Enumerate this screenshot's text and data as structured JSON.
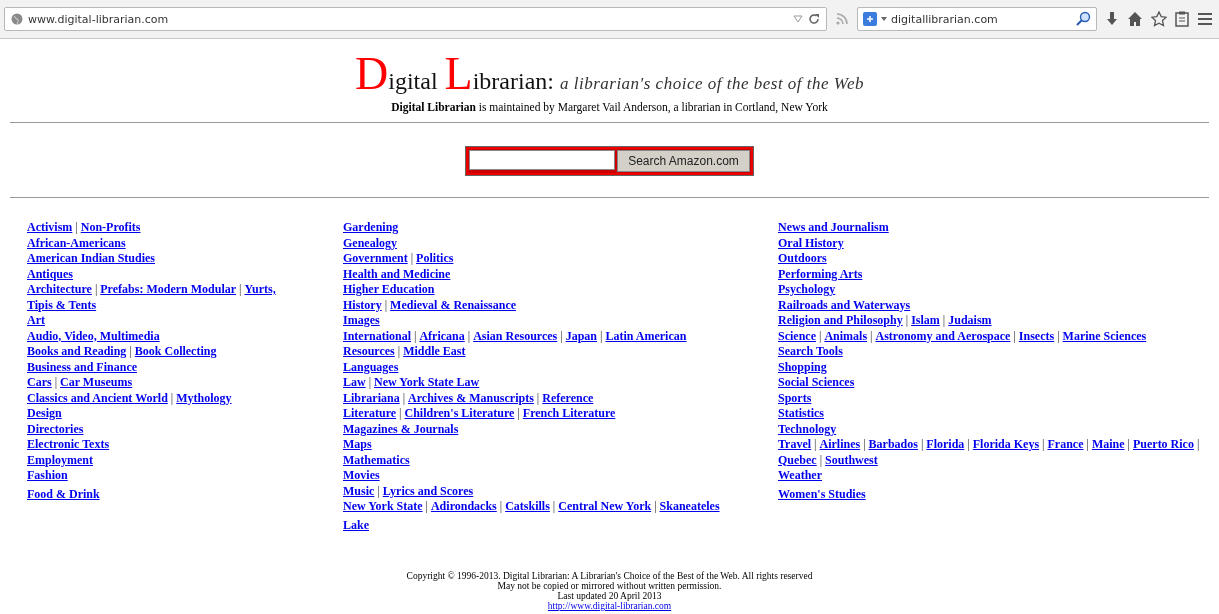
{
  "browser": {
    "url": "www.digital-librarian.com",
    "search_value": "digitallibrarian.com"
  },
  "header": {
    "logo": [
      {
        "initial": "D",
        "rest": "igital"
      },
      {
        "initial": "L",
        "rest": "ibrarian:"
      }
    ],
    "tagline": "a librarian's choice of the best of the Web",
    "byline": "**Digital Librarian** is maintained by Margaret Vail Anderson, a librarian in Cortland, New York"
  },
  "search": {
    "button": "Search Amazon.com"
  },
  "columns": [
    [
      [
        "Activism",
        "|",
        "Non-Profits"
      ],
      [
        "African-Americans"
      ],
      [
        "American Indian Studies"
      ],
      [
        "Antiques"
      ],
      [
        "Architecture",
        "|",
        "Prefabs: Modern Modular",
        "|",
        "Yurts,"
      ],
      [
        "Tipis & Tents"
      ],
      [
        "Art"
      ],
      [
        "Audio, Video, Multimedia"
      ],
      [
        "Books and Reading",
        "|",
        "Book Collecting"
      ],
      [
        "Business and Finance"
      ],
      [
        "Cars",
        "|",
        "Car Museums"
      ],
      [
        "Classics and Ancient World",
        "|",
        "Mythology"
      ],
      [
        "Design"
      ],
      [
        "Directories"
      ],
      [
        "Electronic Texts"
      ],
      [
        "Employment"
      ],
      [
        "Fashion"
      ],
      [
        "Food & Drink"
      ]
    ],
    [
      [
        "Gardening"
      ],
      [
        "Genealogy"
      ],
      [
        "Government",
        "|",
        "Politics"
      ],
      [
        "Health and Medicine"
      ],
      [
        "Higher Education"
      ],
      [
        "History",
        "|",
        "Medieval & Renaissance"
      ],
      [
        "Images"
      ],
      [
        "International",
        "|",
        "Africana",
        "|",
        "Asian Resources",
        "|",
        "Japan",
        "|",
        "Latin American"
      ],
      [
        "Resources",
        "|",
        "Middle East"
      ],
      [
        "Languages"
      ],
      [
        "Law",
        "|",
        "New York State Law"
      ],
      [
        "Librariana",
        "|",
        "Archives & Manuscripts",
        "|",
        "Reference"
      ],
      [
        "Literature",
        "|",
        "Children's Literature",
        "|",
        "French Literature"
      ],
      [
        "Magazines & Journals"
      ],
      [
        "Maps"
      ],
      [
        "Mathematics"
      ],
      [
        "Movies"
      ],
      [
        "Music",
        "|",
        "Lyrics and Scores"
      ],
      [
        "New York State",
        "|",
        "Adirondacks",
        "|",
        "Catskills",
        "|",
        "Central New York",
        "|",
        "Skaneateles"
      ],
      [
        "Lake"
      ]
    ],
    [
      [
        "News and Journalism"
      ],
      [
        "Oral History"
      ],
      [
        "Outdoors"
      ],
      [
        "Performing Arts"
      ],
      [
        "Psychology"
      ],
      [
        "Railroads and Waterways"
      ],
      [
        "Religion and Philosophy",
        "|",
        "Islam",
        "|",
        "Judaism"
      ],
      [
        "Science",
        "|",
        "Animals",
        "|",
        "Astronomy and Aerospace",
        "|",
        "Insects",
        "|",
        "Marine Sciences"
      ],
      [
        "Search Tools"
      ],
      [
        "Shopping"
      ],
      [
        "Social Sciences"
      ],
      [
        "Sports"
      ],
      [
        "Statistics"
      ],
      [
        "Technology"
      ],
      [
        "Travel",
        "|",
        "Airlines",
        "|",
        "Barbados",
        "|",
        "Florida",
        "|",
        "Florida Keys",
        "|",
        "France",
        "|",
        "Maine",
        "|",
        "Puerto Rico",
        "|"
      ],
      [
        "Quebec",
        "|",
        "Southwest"
      ],
      [
        "Weather"
      ],
      [
        "Women's Studies"
      ]
    ]
  ],
  "footer": {
    "lines": [
      "Copyright © 1996-2013. Digital Librarian: A Librarian's Choice of the Best of the Web. All rights reserved",
      "May not be copied or mirrored without written permission.",
      "Last updated 20 April 2013"
    ],
    "link": "http://www.digital-librarian.com"
  }
}
